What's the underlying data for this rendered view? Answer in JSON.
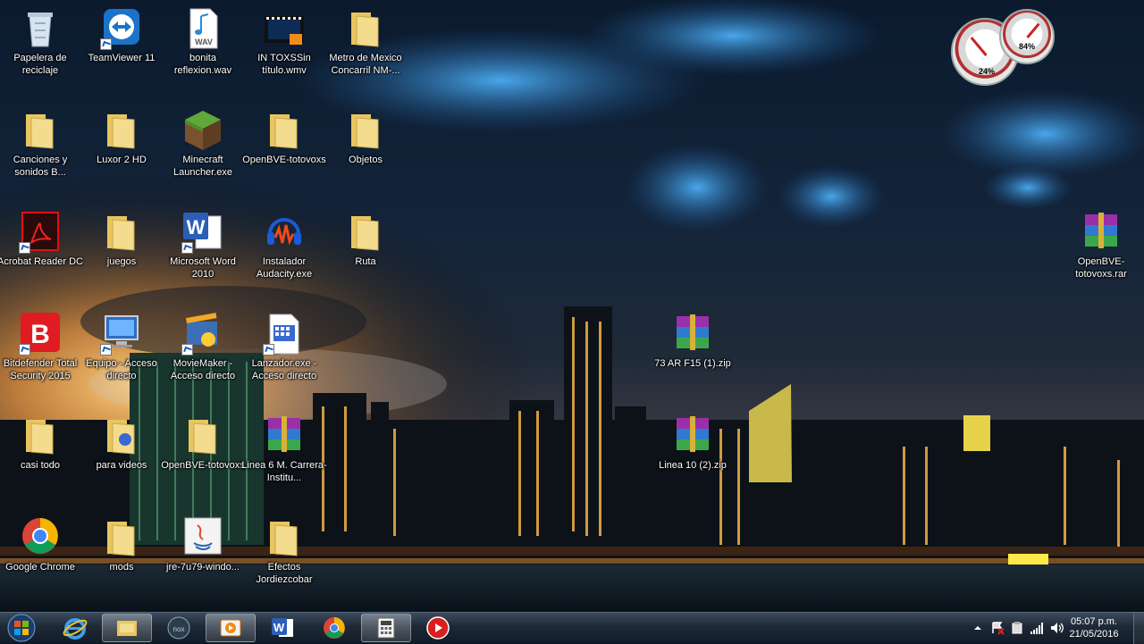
{
  "desktop": {
    "icons": [
      {
        "label": "Papelera de reciclaje",
        "icon": "recycle-bin-icon"
      },
      {
        "label": "TeamViewer 11",
        "icon": "teamviewer-icon"
      },
      {
        "label": "bonita reflexion.wav",
        "icon": "wav-file-icon"
      },
      {
        "label": "IN TOXSSin título.wmv",
        "icon": "video-file-icon"
      },
      {
        "label": "Metro de Mexico Concarril NM-...",
        "icon": "folder-icon"
      },
      {
        "label": "Canciones y sonidos B...",
        "icon": "folder-icon"
      },
      {
        "label": "Luxor 2 HD",
        "icon": "folder-icon"
      },
      {
        "label": "Minecraft Launcher.exe",
        "icon": "minecraft-icon"
      },
      {
        "label": "OpenBVE-totovoxs",
        "icon": "folder-icon"
      },
      {
        "label": "Objetos",
        "icon": "folder-icon"
      },
      {
        "label": "Acrobat Reader DC",
        "icon": "acrobat-icon"
      },
      {
        "label": "juegos",
        "icon": "folder-icon"
      },
      {
        "label": "Microsoft Word 2010",
        "icon": "word-icon"
      },
      {
        "label": "Instalador Audacity.exe",
        "icon": "audacity-icon"
      },
      {
        "label": "Ruta",
        "icon": "folder-icon"
      },
      {
        "label": "Bitdefender Total Security 2015",
        "icon": "bitdefender-icon"
      },
      {
        "label": "Equipo - Acceso directo",
        "icon": "computer-icon"
      },
      {
        "label": "MovieMaker - Acceso directo",
        "icon": "moviemaker-icon"
      },
      {
        "label": "Lanzador.exe - Acceso directo",
        "icon": "launcher-icon"
      },
      {
        "label": "casi todo",
        "icon": "folder-icon"
      },
      {
        "label": "para videos",
        "icon": "folder-icon"
      },
      {
        "label": "OpenBVE-totovoxs",
        "icon": "folder-icon"
      },
      {
        "label": "Linea 6 M. Carrera-Institu...",
        "icon": "winrar-icon"
      },
      {
        "label": "Google Chrome",
        "icon": "chrome-icon"
      },
      {
        "label": "mods",
        "icon": "folder-icon"
      },
      {
        "label": "jre-7u79-windo...",
        "icon": "java-installer-icon"
      },
      {
        "label": "Efectos Jordiezcobar",
        "icon": "folder-icon"
      },
      {
        "label": "73 AR F15 (1).zip",
        "icon": "winrar-icon"
      },
      {
        "label": "Linea 10 (2).zip",
        "icon": "winrar-icon"
      },
      {
        "label": "OpenBVE-totovoxs.rar",
        "icon": "winrar-icon"
      }
    ]
  },
  "gadgets": {
    "cpu_label": "24%",
    "memory_label": "84%"
  },
  "taskbar": {
    "pinned": [
      {
        "name": "internet-explorer-icon"
      },
      {
        "name": "file-explorer-icon"
      },
      {
        "name": "nox-player-icon"
      },
      {
        "name": "media-player-icon"
      },
      {
        "name": "word-icon"
      },
      {
        "name": "chrome-icon"
      },
      {
        "name": "calculator-icon"
      },
      {
        "name": "recorder-icon"
      }
    ],
    "clock_time": "05:07 p.m.",
    "clock_date": "21/05/2016"
  },
  "colors": {
    "folder": "#f0d27a",
    "taskbar": "#1d2937",
    "sky": "#0d1d33"
  }
}
